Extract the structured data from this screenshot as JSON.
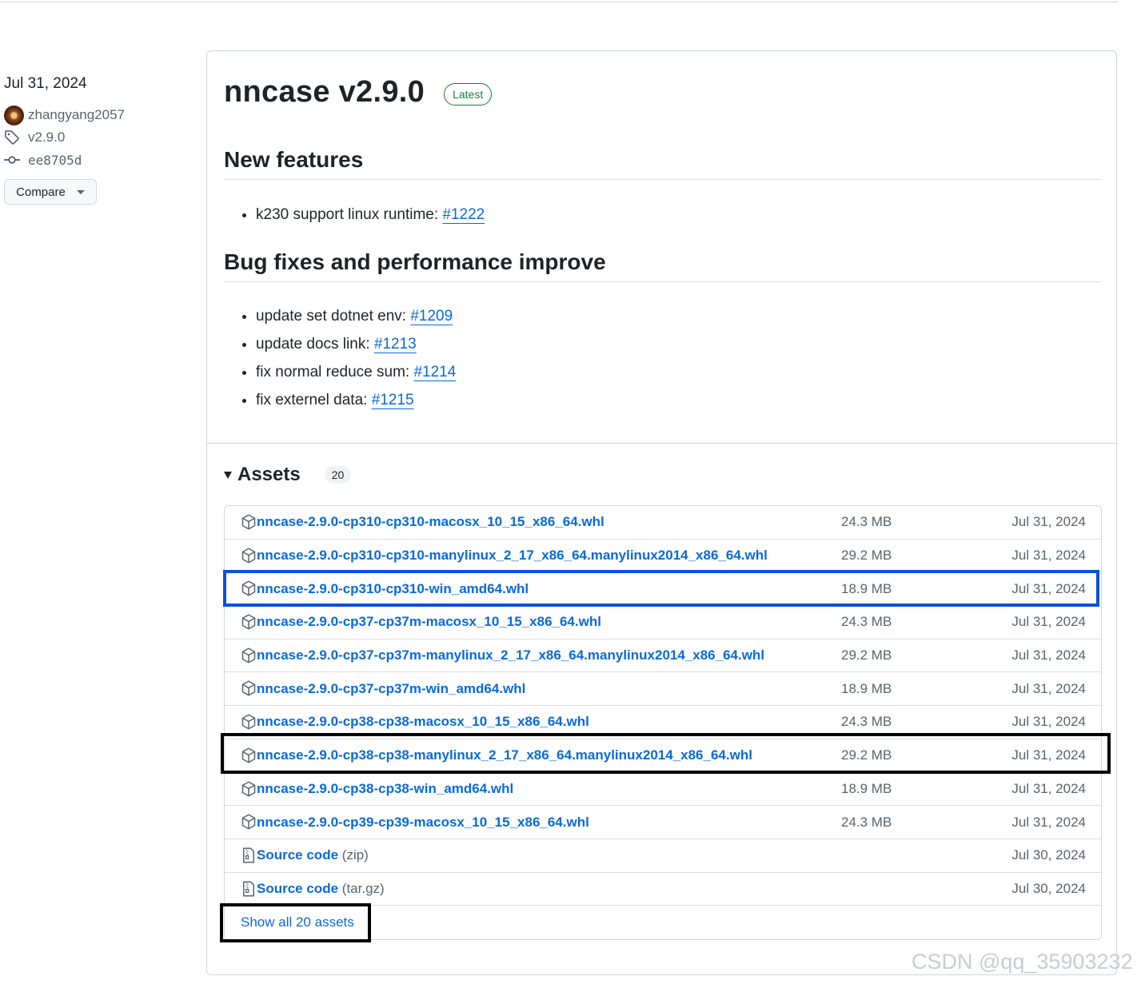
{
  "meta": {
    "date": "Jul 31, 2024",
    "author": "zhangyang2057",
    "tag": "v2.9.0",
    "commit": "ee8705d",
    "compare_label": "Compare"
  },
  "release": {
    "title": "nncase v2.9.0",
    "badge": "Latest",
    "sections": [
      {
        "heading": "New features",
        "items": [
          {
            "text": "k230 support linux runtime: ",
            "link": "#1222"
          }
        ]
      },
      {
        "heading": "Bug fixes and performance improve",
        "items": [
          {
            "text": "update set dotnet env: ",
            "link": "#1209"
          },
          {
            "text": "update docs link: ",
            "link": "#1213"
          },
          {
            "text": "fix normal reduce sum: ",
            "link": "#1214"
          },
          {
            "text": "fix externel data: ",
            "link": "#1215"
          }
        ]
      }
    ]
  },
  "assets": {
    "title": "Assets",
    "count": "20",
    "rows": [
      {
        "name": "nncase-2.9.0-cp310-cp310-macosx_10_15_x86_64.whl",
        "size": "24.3 MB",
        "date": "Jul 31, 2024",
        "icon": "package-icon"
      },
      {
        "name": "nncase-2.9.0-cp310-cp310-manylinux_2_17_x86_64.manylinux2014_x86_64.whl",
        "size": "29.2 MB",
        "date": "Jul 31, 2024",
        "icon": "package-icon"
      },
      {
        "name": "nncase-2.9.0-cp310-cp310-win_amd64.whl",
        "size": "18.9 MB",
        "date": "Jul 31, 2024",
        "icon": "package-icon"
      },
      {
        "name": "nncase-2.9.0-cp37-cp37m-macosx_10_15_x86_64.whl",
        "size": "24.3 MB",
        "date": "Jul 31, 2024",
        "icon": "package-icon"
      },
      {
        "name": "nncase-2.9.0-cp37-cp37m-manylinux_2_17_x86_64.manylinux2014_x86_64.whl",
        "size": "29.2 MB",
        "date": "Jul 31, 2024",
        "icon": "package-icon"
      },
      {
        "name": "nncase-2.9.0-cp37-cp37m-win_amd64.whl",
        "size": "18.9 MB",
        "date": "Jul 31, 2024",
        "icon": "package-icon"
      },
      {
        "name": "nncase-2.9.0-cp38-cp38-macosx_10_15_x86_64.whl",
        "size": "24.3 MB",
        "date": "Jul 31, 2024",
        "icon": "package-icon"
      },
      {
        "name": "nncase-2.9.0-cp38-cp38-manylinux_2_17_x86_64.manylinux2014_x86_64.whl",
        "size": "29.2 MB",
        "date": "Jul 31, 2024",
        "icon": "package-icon"
      },
      {
        "name": "nncase-2.9.0-cp38-cp38-win_amd64.whl",
        "size": "18.9 MB",
        "date": "Jul 31, 2024",
        "icon": "package-icon"
      },
      {
        "name": "nncase-2.9.0-cp39-cp39-macosx_10_15_x86_64.whl",
        "size": "24.3 MB",
        "date": "Jul 31, 2024",
        "icon": "package-icon"
      },
      {
        "name": "Source code",
        "ext": "(zip)",
        "size": "",
        "date": "Jul 30, 2024",
        "icon": "file-zip-icon"
      },
      {
        "name": "Source code",
        "ext": "(tar.gz)",
        "size": "",
        "date": "Jul 30, 2024",
        "icon": "file-zip-icon"
      }
    ],
    "show_all": "Show all 20 assets"
  },
  "colors": {
    "link": "#0969da",
    "muted": "#59636e",
    "latest": "#1a7f37",
    "highlight_blue": "#0b4fe0",
    "highlight_black": "#000000"
  },
  "watermark": "CSDN @qq_35903232"
}
